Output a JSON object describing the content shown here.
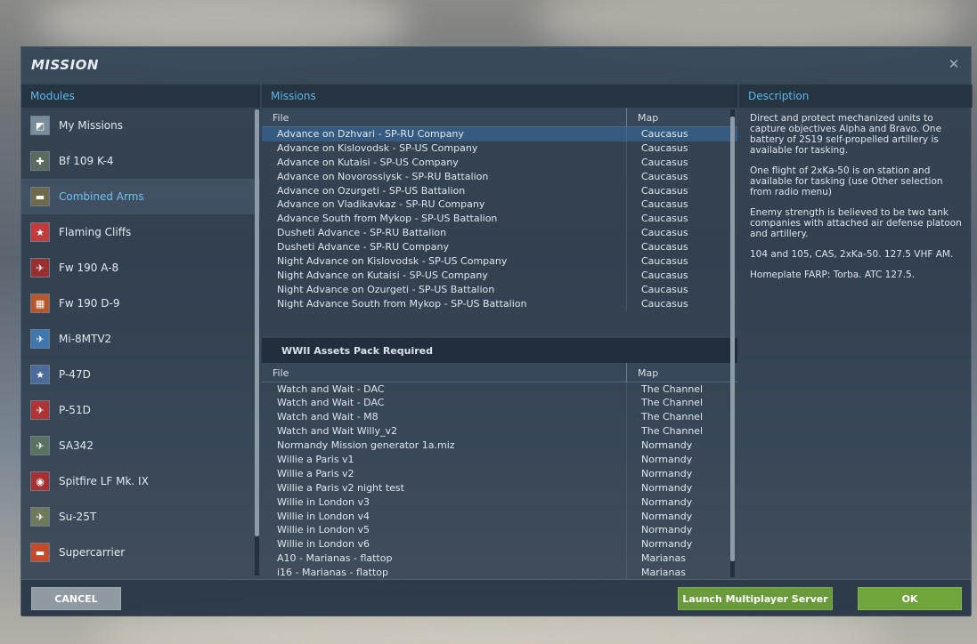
{
  "dialog": {
    "title": "MISSION",
    "close_glyph": "✕"
  },
  "columns": {
    "modules": "Modules",
    "missions": "Missions",
    "description": "Description"
  },
  "modules": [
    {
      "label": "My Missions",
      "icon": "map-icon",
      "color": "#7a8c9a",
      "glyph": "◩"
    },
    {
      "label": "Bf 109 K-4",
      "icon": "bf109-icon",
      "color": "#5b6b5e",
      "glyph": "✚"
    },
    {
      "label": "Combined Arms",
      "icon": "tank-icon",
      "color": "#6e6a4a",
      "glyph": "▬"
    },
    {
      "label": "Flaming Cliffs",
      "icon": "flaming-cliffs-icon",
      "color": "#c23a3a",
      "glyph": "★"
    },
    {
      "label": "Fw 190 A-8",
      "icon": "fw190a8-icon",
      "color": "#9a2f2f",
      "glyph": "✈"
    },
    {
      "label": "Fw 190 D-9",
      "icon": "fw190d9-icon",
      "color": "#b9572a",
      "glyph": "▦"
    },
    {
      "label": "Mi-8MTV2",
      "icon": "helicopter-icon",
      "color": "#3f77b0",
      "glyph": "✈"
    },
    {
      "label": "P-47D",
      "icon": "p47d-icon",
      "color": "#4b6c9a",
      "glyph": "★"
    },
    {
      "label": "P-51D",
      "icon": "p51d-icon",
      "color": "#b03434",
      "glyph": "✈"
    },
    {
      "label": "SA342",
      "icon": "sa342-icon",
      "color": "#5a7260",
      "glyph": "✈"
    },
    {
      "label": "Spitfire LF Mk. IX",
      "icon": "spitfire-icon",
      "color": "#a83030",
      "glyph": "◉"
    },
    {
      "label": "Su-25T",
      "icon": "su25t-icon",
      "color": "#6f7a5a",
      "glyph": "✈"
    },
    {
      "label": "Supercarrier",
      "icon": "supercarrier-icon",
      "color": "#c54a2a",
      "glyph": "▬"
    }
  ],
  "table": {
    "file_header": "File",
    "map_header": "Map"
  },
  "missions_group1": [
    {
      "file": "Advance on Dzhvari - SP-RU Company",
      "map": "Caucasus"
    },
    {
      "file": "Advance on Kislovodsk - SP-US Company",
      "map": "Caucasus"
    },
    {
      "file": "Advance on Kutaisi - SP-US Company",
      "map": "Caucasus"
    },
    {
      "file": "Advance on Novorossiysk - SP-RU Battalion",
      "map": "Caucasus"
    },
    {
      "file": "Advance on Ozurgeti - SP-US Battalion",
      "map": "Caucasus"
    },
    {
      "file": "Advance on Vladikavkaz - SP-RU Company",
      "map": "Caucasus"
    },
    {
      "file": "Advance South from Mykop - SP-US Battalion",
      "map": "Caucasus"
    },
    {
      "file": "Dusheti Advance - SP-RU Battalion",
      "map": "Caucasus"
    },
    {
      "file": "Dusheti Advance - SP-RU Company",
      "map": "Caucasus"
    },
    {
      "file": "Night Advance on Kislovodsk - SP-US Company",
      "map": "Caucasus"
    },
    {
      "file": "Night Advance on Kutaisi - SP-US Company",
      "map": "Caucasus"
    },
    {
      "file": "Night Advance on Ozurgeti - SP-US Battalion",
      "map": "Caucasus"
    },
    {
      "file": "Night Advance South from Mykop - SP-US Battalion",
      "map": "Caucasus"
    }
  ],
  "section2_title": "WWII Assets Pack Required",
  "missions_group2": [
    {
      "file": "Watch and Wait - DAC",
      "map": "The Channel"
    },
    {
      "file": "Watch and Wait - DAC",
      "map": "The Channel"
    },
    {
      "file": "Watch and Wait - M8",
      "map": "The Channel"
    },
    {
      "file": "Watch and Wait Willy_v2",
      "map": "The Channel"
    },
    {
      "file": "Normandy Mission generator 1a.miz",
      "map": "Normandy"
    },
    {
      "file": "Willie a Paris v1",
      "map": "Normandy"
    },
    {
      "file": "Willie a Paris v2",
      "map": "Normandy"
    },
    {
      "file": "Willie a Paris v2 night test",
      "map": "Normandy"
    },
    {
      "file": "Willie in London v3",
      "map": "Normandy"
    },
    {
      "file": "Willie in London v4",
      "map": "Normandy"
    },
    {
      "file": "Willie in London v5",
      "map": "Normandy"
    },
    {
      "file": "Willie in London v6",
      "map": "Normandy"
    },
    {
      "file": "A10 - Marianas - flattop",
      "map": "Marianas"
    },
    {
      "file": "i16 - Marianas - flattop",
      "map": "Marianas"
    }
  ],
  "description": {
    "paragraphs": [
      "Direct and protect mechanized units to capture objectives Alpha and Bravo. One battery of 2S19 self-propelled artillery is available for tasking.",
      "One flight of 2xKa-50 is on station and available for tasking (use Other selection from radio menu)",
      "Enemy strength is believed to be two tank companies with attached air defense platoon and artillery.",
      "104 and 105, CAS, 2xKa-50. 127.5 VHF AM.",
      "Homeplate FARP: Torba. ATC 127.5."
    ]
  },
  "buttons": {
    "cancel": "CANCEL",
    "server": "Launch Multiplayer Server",
    "ok": "OK"
  },
  "colors": {
    "accent": "#5db8e8",
    "ok_green": "#6fa53a",
    "selected_row": "#355b80"
  }
}
